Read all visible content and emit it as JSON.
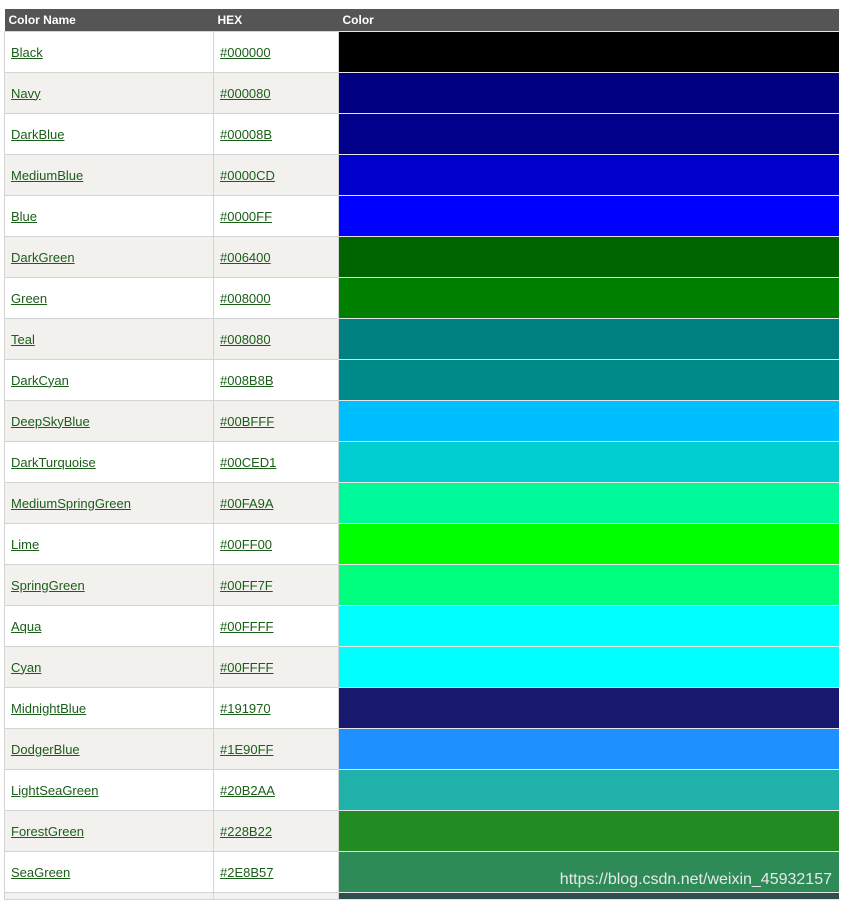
{
  "header": {
    "col_name": "Color Name",
    "col_hex": "HEX",
    "col_color": "Color"
  },
  "rows": [
    {
      "name": "Black",
      "hex": "#000000",
      "color": "#000000"
    },
    {
      "name": "Navy",
      "hex": "#000080",
      "color": "#000080"
    },
    {
      "name": "DarkBlue",
      "hex": "#00008B",
      "color": "#00008B"
    },
    {
      "name": "MediumBlue",
      "hex": "#0000CD",
      "color": "#0000CD"
    },
    {
      "name": "Blue",
      "hex": "#0000FF",
      "color": "#0000FF"
    },
    {
      "name": "DarkGreen",
      "hex": "#006400",
      "color": "#006400"
    },
    {
      "name": "Green",
      "hex": "#008000",
      "color": "#008000"
    },
    {
      "name": "Teal",
      "hex": "#008080",
      "color": "#008080"
    },
    {
      "name": "DarkCyan",
      "hex": "#008B8B",
      "color": "#008B8B"
    },
    {
      "name": "DeepSkyBlue",
      "hex": "#00BFFF",
      "color": "#00BFFF"
    },
    {
      "name": "DarkTurquoise",
      "hex": "#00CED1",
      "color": "#00CED1"
    },
    {
      "name": "MediumSpringGreen",
      "hex": "#00FA9A",
      "color": "#00FA9A"
    },
    {
      "name": "Lime",
      "hex": "#00FF00",
      "color": "#00FF00"
    },
    {
      "name": "SpringGreen",
      "hex": "#00FF7F",
      "color": "#00FF7F"
    },
    {
      "name": "Aqua",
      "hex": "#00FFFF",
      "color": "#00FFFF"
    },
    {
      "name": "Cyan",
      "hex": "#00FFFF",
      "color": "#00FFFF"
    },
    {
      "name": "MidnightBlue",
      "hex": "#191970",
      "color": "#191970"
    },
    {
      "name": "DodgerBlue",
      "hex": "#1E90FF",
      "color": "#1E90FF"
    },
    {
      "name": "LightSeaGreen",
      "hex": "#20B2AA",
      "color": "#20B2AA"
    },
    {
      "name": "ForestGreen",
      "hex": "#228B22",
      "color": "#228B22"
    },
    {
      "name": "SeaGreen",
      "hex": "#2E8B57",
      "color": "#2E8B57"
    }
  ],
  "partial_row_color": "#2F4F4F",
  "watermark": "https://blog.csdn.net/weixin_45932157"
}
